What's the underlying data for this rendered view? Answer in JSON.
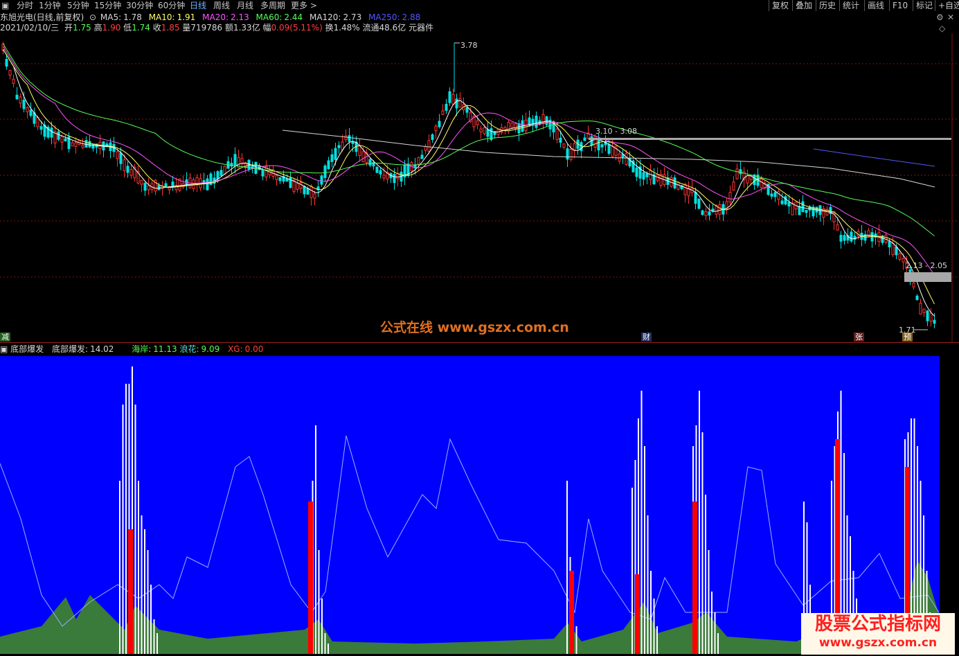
{
  "toolbar": {
    "tabs": [
      "分时",
      "1分钟",
      "5分钟",
      "15分钟",
      "30分钟",
      "60分钟",
      "日线",
      "周线",
      "月线",
      "多周期",
      "更多 >"
    ],
    "active_tab": "日线",
    "right_buttons": [
      "复权",
      "叠加",
      "历史",
      "统计",
      "画线",
      "F10",
      "标记",
      "+自选"
    ]
  },
  "header": {
    "stock_name": "东旭光电(日线,前复权)",
    "ma5_label": "MA5:",
    "ma5": "1.78",
    "ma10_label": "MA10:",
    "ma10": "1.91",
    "ma20_label": "MA20:",
    "ma20": "2.13",
    "ma60_label": "MA60:",
    "ma60": "2.44",
    "ma120_label": "MA120:",
    "ma120": "2.73",
    "ma250_label": "MA250:",
    "ma250": "2.88"
  },
  "info": {
    "date": "2021/02/10/三",
    "open_label": "开",
    "open": "1.75",
    "high_label": "高",
    "high": "1.90",
    "low_label": "低",
    "low": "1.74",
    "close_label": "收",
    "close": "1.85",
    "volume_label": "量",
    "volume": "719786",
    "amount_label": "额",
    "amount": "1.33亿",
    "change_label": "幅",
    "change": "0.09(5.11%)",
    "turnover": "换1.48%",
    "float_cap": "流通48.6亿",
    "sector": "元器件"
  },
  "annotations": {
    "peak": "3.78",
    "zone1": "3.10 - 3.08",
    "zone2": "2.13 - 2.05",
    "low": "1.71",
    "watermark": "公式在线  www.gszx.com.cn",
    "badge_left": "减",
    "badge_mid": "财",
    "badge_r1": "张",
    "badge_r2": "预",
    "bottom_watermark": "股票公式指标网",
    "bottom_url": "www.gszx.com.cn"
  },
  "indicator": {
    "name": "底部爆发",
    "label": "底部爆发:",
    "value": "14.02",
    "haian_label": "海岸:",
    "haian": "11.13",
    "langhua_label": "浪花:",
    "langhua": "9.09",
    "xg_label": "XG:",
    "xg": "0.00"
  },
  "colors": {
    "ma5": "#ffffff",
    "ma10": "#ffff66",
    "ma20": "#ff55ff",
    "ma60": "#55ff55",
    "ma120": "#d8d8d8",
    "ma250": "#5555ff",
    "up": "#ff3333",
    "down": "#00e0e0",
    "panel_bg": "#0000ff",
    "area": "#3a7a3a",
    "bar": "#ff0000"
  }
}
